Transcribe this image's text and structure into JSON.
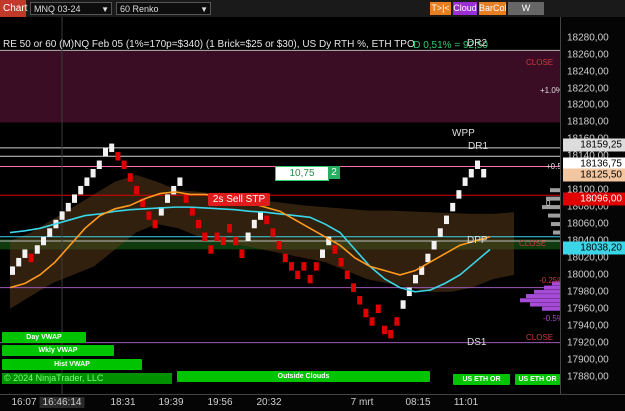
{
  "toolbar": {
    "chart_label": "Chart",
    "symbol": "MNQ 03-24",
    "bar_type": "60 Renko",
    "buttons": [
      "T>|<",
      "Cloud",
      "BarCol",
      "W VWAP"
    ]
  },
  "header": {
    "description": "RE 50 or 60 (M)NQ Feb 05 (1%=170p=$340) (1 Brick=$25 or $30), US Dy RTH %, ETH TPO",
    "delta": "D 0,51% = 92,50"
  },
  "levels": {
    "dr2": "DR2",
    "wpp": "WPP",
    "dr1": "DR1",
    "dpp": "DPP",
    "ds1": "DS1",
    "close_marks": [
      "CLOSE",
      "CLOSE",
      "CLOSE"
    ],
    "pct_marks": [
      "+1.0%",
      "+0.5%",
      "0",
      "-0.25%",
      "-0.5%"
    ]
  },
  "order": {
    "qty_value": "10,75",
    "qty_count": "2",
    "sell_label": "2s  Sell STP"
  },
  "price_axis": {
    "labels": [
      "18280,00",
      "18260,00",
      "18240,00",
      "18220,00",
      "18200,00",
      "18180,00",
      "18160,00",
      "18140,00",
      "18120,00",
      "18100,00",
      "18080,00",
      "18060,00",
      "18040,00",
      "18020,00",
      "18000,00",
      "17980,00",
      "17960,00",
      "17940,00",
      "17920,00",
      "17900,00",
      "17880,00"
    ],
    "boxes": [
      "18159,25",
      "18136,75",
      "18125,50",
      "18096,00",
      "18038,20"
    ]
  },
  "time_axis": {
    "labels": [
      "16:07",
      "16:46:14",
      "18:31",
      "19:39",
      "19:56",
      "20:32",
      "7 mrt",
      "08:15",
      "11:01"
    ]
  },
  "pills": {
    "day_vwap": "Day VWAP",
    "wkly_vwap": "Wkly VWAP",
    "hist_vwap": "Hist VWAP",
    "outside_clouds": "Outside Clouds",
    "eth_1": "US ETH OR",
    "eth_2": "US ETH OR"
  },
  "footer": {
    "copyright": "© 2024 NinjaTrader, LLC"
  },
  "colors": {
    "up": "#f2f2f2",
    "down": "#e00000",
    "cyan": "#3ad6e8",
    "orange": "#ff9a1f",
    "cloud": "#5a3a1a",
    "band": "#3a0d24"
  },
  "chart_data": {
    "type": "renko",
    "brick_size": 5,
    "ylim": [
      17870,
      18295
    ],
    "bricks": [
      {
        "p": 18005,
        "d": "up"
      },
      {
        "p": 18015,
        "d": "up"
      },
      {
        "p": 18025,
        "d": "up"
      },
      {
        "p": 18020,
        "d": "down"
      },
      {
        "p": 18030,
        "d": "up"
      },
      {
        "p": 18040,
        "d": "up"
      },
      {
        "p": 18050,
        "d": "up"
      },
      {
        "p": 18060,
        "d": "up"
      },
      {
        "p": 18070,
        "d": "up"
      },
      {
        "p": 18080,
        "d": "up"
      },
      {
        "p": 18090,
        "d": "up"
      },
      {
        "p": 18100,
        "d": "up"
      },
      {
        "p": 18110,
        "d": "up"
      },
      {
        "p": 18120,
        "d": "up"
      },
      {
        "p": 18130,
        "d": "up"
      },
      {
        "p": 18145,
        "d": "up"
      },
      {
        "p": 18150,
        "d": "up"
      },
      {
        "p": 18140,
        "d": "down"
      },
      {
        "p": 18130,
        "d": "down"
      },
      {
        "p": 18115,
        "d": "down"
      },
      {
        "p": 18100,
        "d": "down"
      },
      {
        "p": 18085,
        "d": "down"
      },
      {
        "p": 18070,
        "d": "down"
      },
      {
        "p": 18060,
        "d": "down"
      },
      {
        "p": 18075,
        "d": "up"
      },
      {
        "p": 18090,
        "d": "up"
      },
      {
        "p": 18100,
        "d": "up"
      },
      {
        "p": 18110,
        "d": "up"
      },
      {
        "p": 18090,
        "d": "down"
      },
      {
        "p": 18075,
        "d": "down"
      },
      {
        "p": 18060,
        "d": "down"
      },
      {
        "p": 18045,
        "d": "down"
      },
      {
        "p": 18030,
        "d": "down"
      },
      {
        "p": 18045,
        "d": "down"
      },
      {
        "p": 18040,
        "d": "down"
      },
      {
        "p": 18055,
        "d": "down"
      },
      {
        "p": 18040,
        "d": "down"
      },
      {
        "p": 18025,
        "d": "down"
      },
      {
        "p": 18045,
        "d": "up"
      },
      {
        "p": 18060,
        "d": "up"
      },
      {
        "p": 18070,
        "d": "up"
      },
      {
        "p": 18065,
        "d": "down"
      },
      {
        "p": 18050,
        "d": "down"
      },
      {
        "p": 18035,
        "d": "down"
      },
      {
        "p": 18020,
        "d": "down"
      },
      {
        "p": 18010,
        "d": "down"
      },
      {
        "p": 18000,
        "d": "down"
      },
      {
        "p": 18010,
        "d": "down"
      },
      {
        "p": 17995,
        "d": "down"
      },
      {
        "p": 18010,
        "d": "down"
      },
      {
        "p": 18025,
        "d": "up"
      },
      {
        "p": 18040,
        "d": "up"
      },
      {
        "p": 18030,
        "d": "down"
      },
      {
        "p": 18015,
        "d": "down"
      },
      {
        "p": 18000,
        "d": "down"
      },
      {
        "p": 17985,
        "d": "down"
      },
      {
        "p": 17970,
        "d": "down"
      },
      {
        "p": 17955,
        "d": "down"
      },
      {
        "p": 17945,
        "d": "down"
      },
      {
        "p": 17960,
        "d": "down"
      },
      {
        "p": 17935,
        "d": "down"
      },
      {
        "p": 17930,
        "d": "down"
      },
      {
        "p": 17945,
        "d": "down"
      },
      {
        "p": 17965,
        "d": "up"
      },
      {
        "p": 17980,
        "d": "up"
      },
      {
        "p": 17995,
        "d": "up"
      },
      {
        "p": 18005,
        "d": "up"
      },
      {
        "p": 18020,
        "d": "up"
      },
      {
        "p": 18035,
        "d": "up"
      },
      {
        "p": 18050,
        "d": "up"
      },
      {
        "p": 18065,
        "d": "up"
      },
      {
        "p": 18080,
        "d": "up"
      },
      {
        "p": 18095,
        "d": "up"
      },
      {
        "p": 18110,
        "d": "up"
      },
      {
        "p": 18120,
        "d": "up"
      },
      {
        "p": 18130,
        "d": "up"
      },
      {
        "p": 18120,
        "d": "up"
      }
    ],
    "series": [
      {
        "name": "cyan",
        "values": [
          18050,
          18052,
          18055,
          18060,
          18065,
          18070,
          18072,
          18075,
          18077,
          18078,
          18079,
          18080,
          18080,
          18079,
          18078,
          18077,
          18075,
          18074,
          18072,
          18070,
          18068,
          18060,
          18050,
          18030,
          18010,
          17995,
          17985,
          17980,
          17982,
          17990,
          18000,
          18015,
          18030
        ]
      },
      {
        "name": "orange",
        "values": [
          17985,
          17990,
          18000,
          18015,
          18035,
          18055,
          18070,
          18078,
          18082,
          18090,
          18096,
          18098,
          18095,
          18095,
          18093,
          18090,
          18085,
          18080,
          18075,
          18065,
          18055,
          18045,
          18035,
          18020,
          18010,
          18005,
          18000,
          18005,
          18015,
          18025,
          18035,
          18040,
          18045
        ]
      }
    ]
  }
}
